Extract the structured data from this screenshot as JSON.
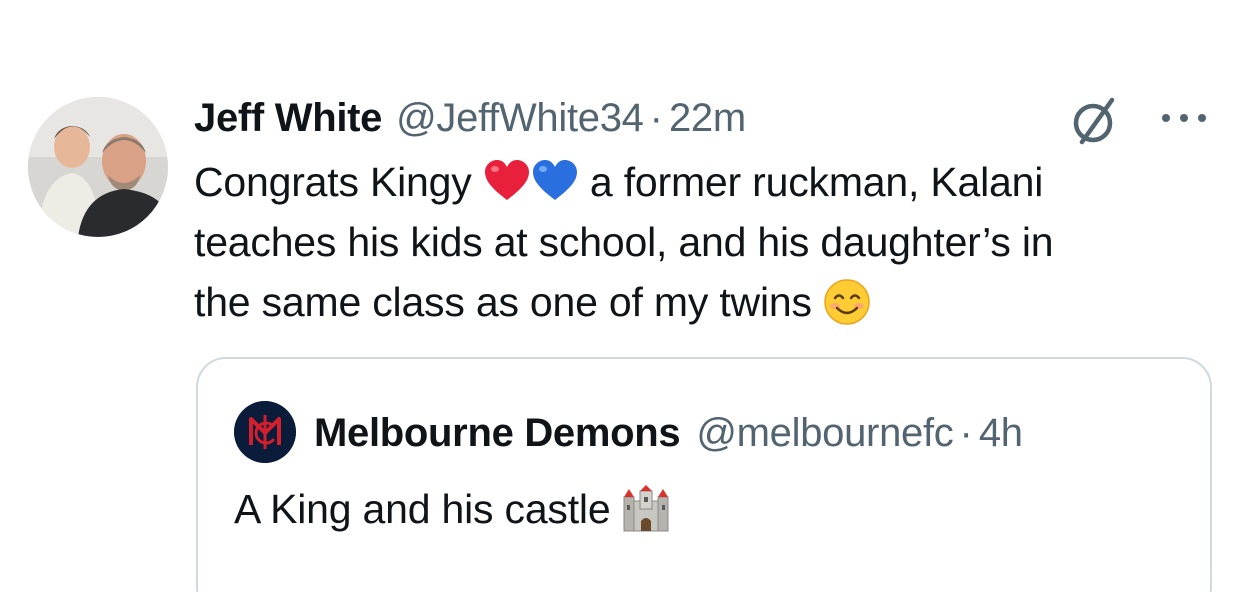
{
  "tweet": {
    "author_name": "Jeff White",
    "author_handle": "@JeffWhite34",
    "separator": "·",
    "timestamp": "22m",
    "avatar_icon": "profile-photo",
    "grok_icon": "grok-slash-icon",
    "more_icon": "more-horizontal-icon",
    "text": {
      "line1_a": "Congrats Kingy",
      "line1_b": "a former ruckman, Kalani",
      "line2": "teaches his kids at school, and his daughter’s in",
      "line3": "the same class as one of my twins"
    },
    "emojis": [
      "red-heart",
      "blue-heart",
      "smiling-face"
    ]
  },
  "quote": {
    "author_name": "Melbourne Demons",
    "author_handle": "@melbournefc",
    "separator": "·",
    "timestamp": "4h",
    "avatar_icon": "melbourne-fc-logo",
    "text": "A King and his castle",
    "emoji": "castle"
  },
  "colors": {
    "text_primary": "#0f1419",
    "text_secondary": "#536471",
    "border": "#cfd9de",
    "heart_red": "#e8203b",
    "heart_blue": "#2a6fe0",
    "logo_navy": "#0b1c3a",
    "logo_red": "#d11f2e"
  }
}
